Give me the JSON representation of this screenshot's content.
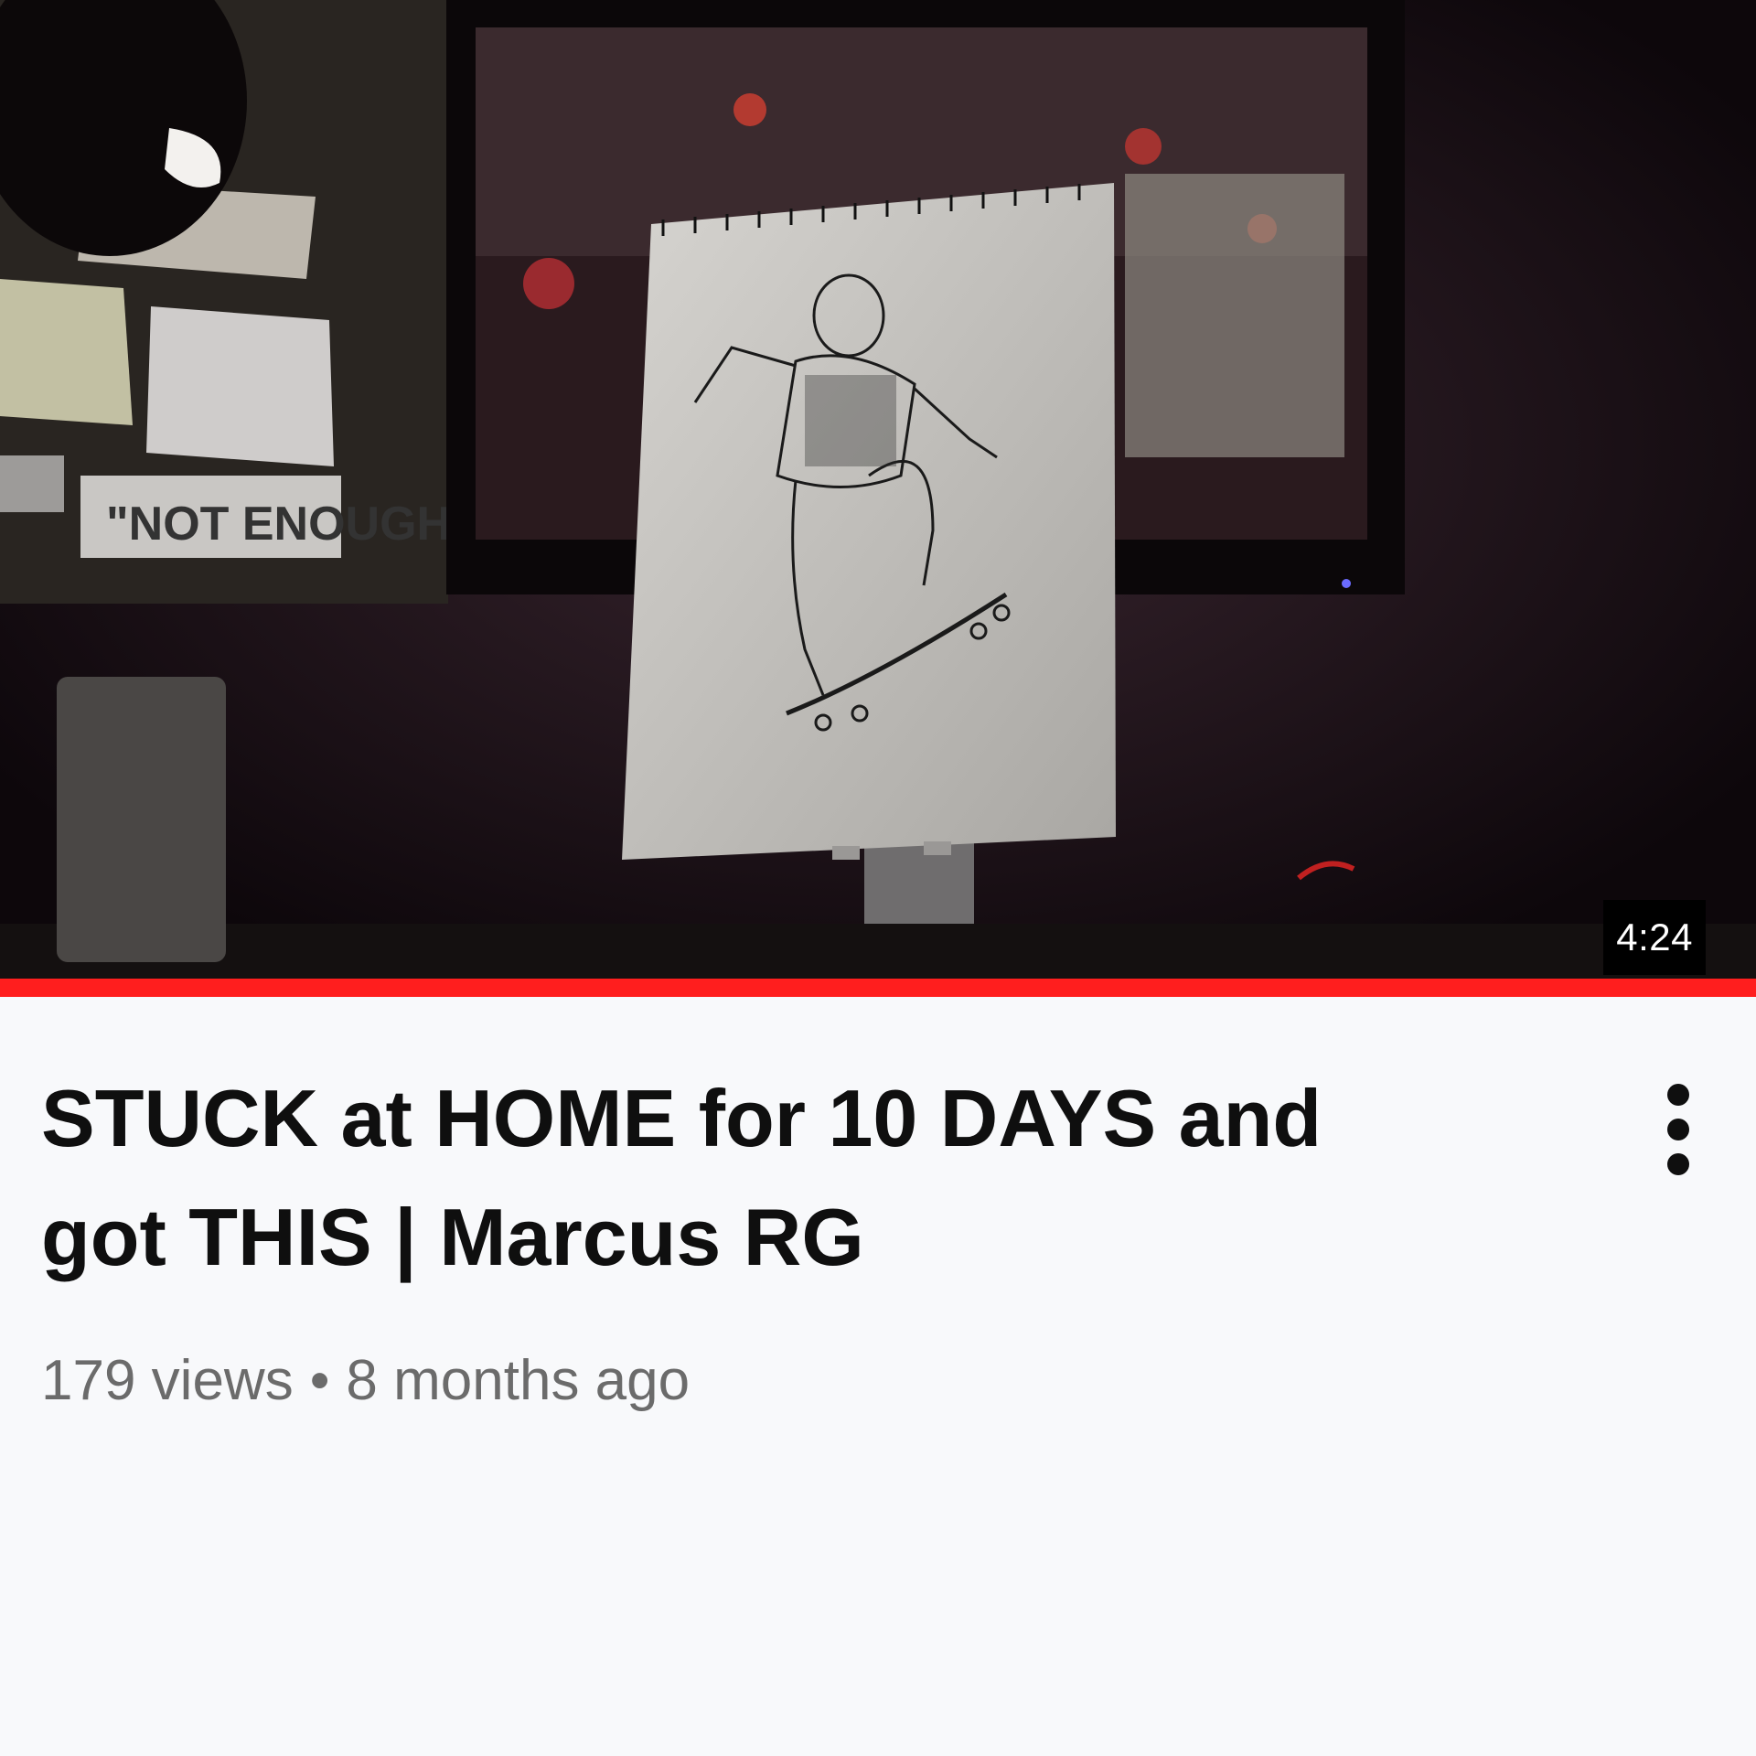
{
  "video": {
    "duration": "4:24",
    "watch_progress": 1.0,
    "progress_color": "#ff1e1e",
    "title": "STUCK at HOME for 10 DAYS and got THIS | Marcus RG",
    "views": "179 views",
    "separator": "•",
    "age": "8 months ago"
  },
  "thumbnail": {
    "sign_text": "\"NOT ENOUGH\""
  },
  "icons": {
    "menu": "more-vert-icon"
  }
}
